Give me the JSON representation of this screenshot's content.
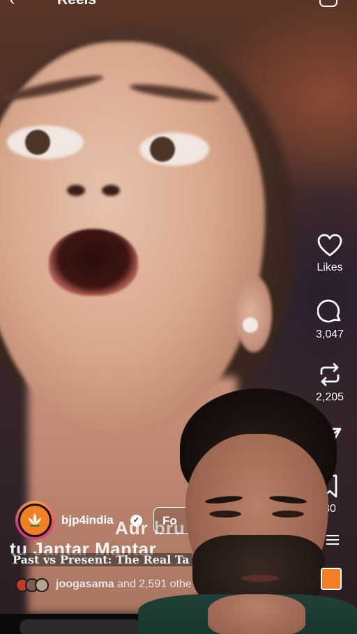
{
  "topbar": {
    "back_icon": "back-arrow-icon",
    "title": "Reels",
    "camera_icon": "camera-icon"
  },
  "actions": {
    "like": {
      "icon": "heart-icon",
      "label": "Likes"
    },
    "comment": {
      "icon": "comment-icon",
      "count": "3,047"
    },
    "repost": {
      "icon": "repost-icon",
      "count": "2,205"
    },
    "share": {
      "icon": "send-icon",
      "count": ""
    },
    "save": {
      "icon": "bookmark-icon",
      "count": "30"
    },
    "more": {
      "icon": "more-icon"
    }
  },
  "post": {
    "username": "bjp4india",
    "verified": true,
    "follow_label": "Fo",
    "overlay_line_1": "Aur bru",
    "overlay_line_2": "tu Jantar Mantar",
    "caption": "Past vs Present: The Real Ta",
    "liked_by_user": "joogasama",
    "liked_by_rest": "and 2,591 othe"
  },
  "colors": {
    "accent_orange": "#f27f23",
    "text": "#ffffff"
  }
}
